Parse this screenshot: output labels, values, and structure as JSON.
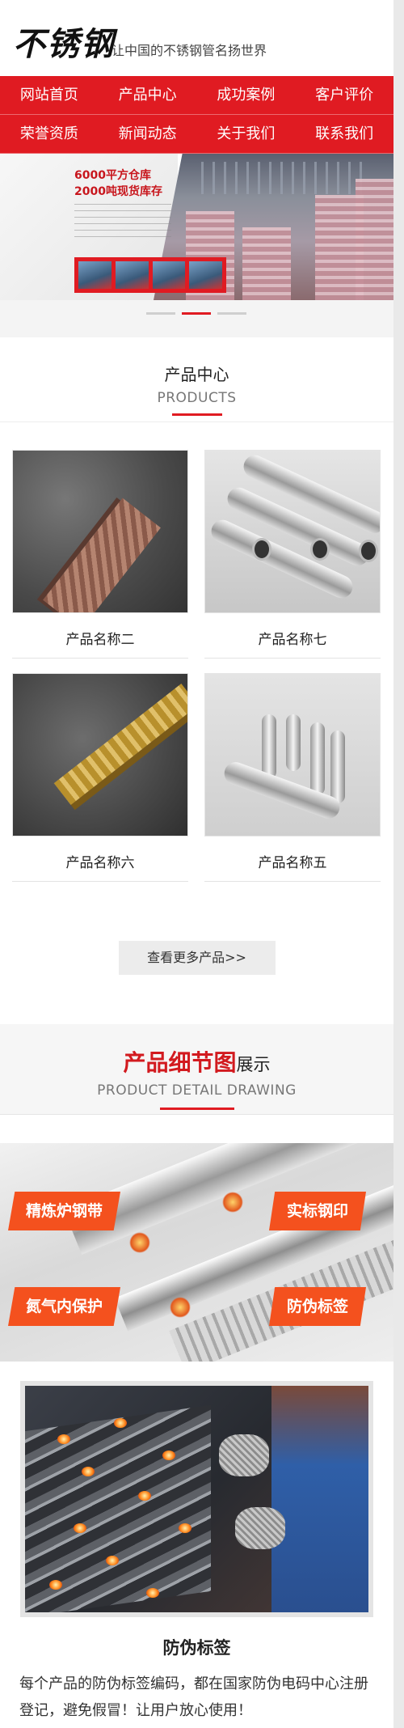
{
  "header": {
    "logo_text": "不锈钢",
    "slogan": "让中国的不锈钢管名扬世界"
  },
  "nav": {
    "items": [
      {
        "label": "网站首页"
      },
      {
        "label": "产品中心"
      },
      {
        "label": "成功案例"
      },
      {
        "label": "客户评价"
      },
      {
        "label": "荣誉资质"
      },
      {
        "label": "新闻动态"
      },
      {
        "label": "关于我们"
      },
      {
        "label": "联系我们"
      }
    ]
  },
  "banner": {
    "line1": "6000平方仓库",
    "line2": "2000吨现货库存",
    "slides": 3,
    "active_slide": 2
  },
  "products": {
    "title_cn": "产品中心",
    "title_en": "PRODUCTS",
    "items": [
      {
        "name": "产品名称二"
      },
      {
        "name": "产品名称七"
      },
      {
        "name": "产品名称六"
      },
      {
        "name": "产品名称五"
      }
    ],
    "more_label": "查看更多产品>>"
  },
  "detail": {
    "title_highlight": "产品细节图",
    "title_rest": "展示",
    "title_en": "PRODUCT DETAIL DRAWING",
    "tags": [
      "精炼炉钢带",
      "实标钢印",
      "氮气内保护",
      "防伪标签"
    ]
  },
  "feature_caption": {
    "title": "防伪标签",
    "text": "每个产品的防伪标签编码，都在国家防伪电码中心注册登记，避免假冒！让用户放心使用！"
  },
  "colors": {
    "brand_red": "#e01b22",
    "tag_orange": "#f4511e"
  }
}
